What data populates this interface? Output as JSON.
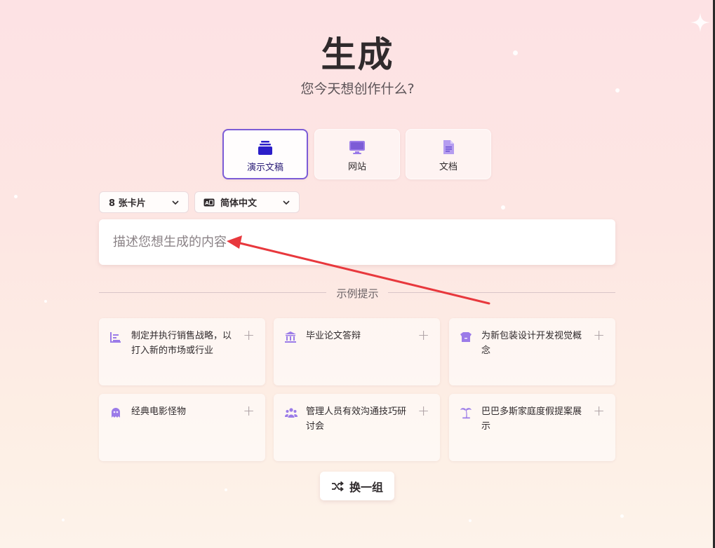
{
  "header": {
    "title": "生成",
    "subtitle": "您今天想创作什么?"
  },
  "types": [
    {
      "label": "演示文稿",
      "icon": "presentation-stack-icon",
      "selected": true
    },
    {
      "label": "网站",
      "icon": "monitor-icon",
      "selected": false
    },
    {
      "label": "文档",
      "icon": "document-icon",
      "selected": false
    }
  ],
  "options": {
    "card_count": "8 张卡片",
    "language": "简体中文",
    "language_icon": "language-badge-icon"
  },
  "prompt": {
    "placeholder": "描述您想生成的内容"
  },
  "examples": {
    "heading": "示例提示",
    "items": [
      {
        "text": "制定并执行销售战略，以打入新的市场或行业",
        "icon": "bar-chart-icon"
      },
      {
        "text": "毕业论文答辩",
        "icon": "university-icon"
      },
      {
        "text": "为新包装设计开发视觉概念",
        "icon": "box-icon"
      },
      {
        "text": "经典电影怪物",
        "icon": "ghost-icon"
      },
      {
        "text": "管理人员有效沟通技巧研讨会",
        "icon": "people-icon"
      },
      {
        "text": "巴巴多斯家庭度假提案展示",
        "icon": "palm-tree-icon"
      }
    ],
    "add_symbol": "+"
  },
  "shuffle": {
    "label": "换一组",
    "icon": "shuffle-icon"
  },
  "colors": {
    "accent": "#7c5cd6",
    "icon_purple": "#9b7be8",
    "annotation_arrow": "#e8383d"
  }
}
